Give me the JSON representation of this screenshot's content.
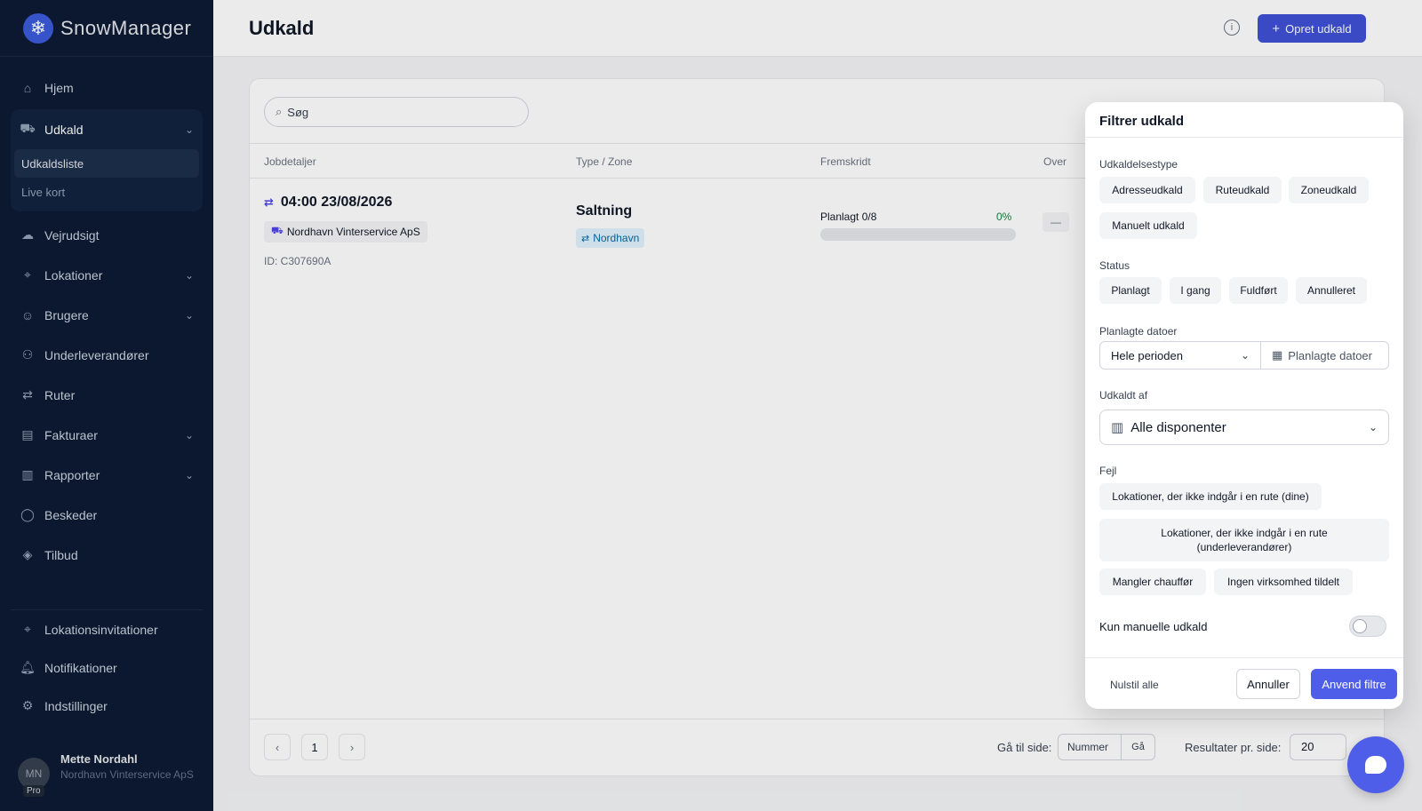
{
  "app": {
    "name": "SnowManager"
  },
  "colors": {
    "sidebar": "#0c1b33",
    "accent": "#4f5ee8",
    "success": "#15803d",
    "zone": "#0369a1"
  },
  "sidebar": {
    "items": [
      {
        "label": "Hjem",
        "icon": "home-icon"
      },
      {
        "label": "Udkald",
        "icon": "truck-icon",
        "expanded": true,
        "children": [
          {
            "label": "Udkaldsliste",
            "active": true
          },
          {
            "label": "Live kort"
          }
        ]
      },
      {
        "label": "Vejrudsigt",
        "icon": "cloud-icon"
      },
      {
        "label": "Lokationer",
        "icon": "location-icon",
        "chevron": true
      },
      {
        "label": "Brugere",
        "icon": "user-icon",
        "chevron": true
      },
      {
        "label": "Underleverandører",
        "icon": "users-icon"
      },
      {
        "label": "Ruter",
        "icon": "route-icon"
      },
      {
        "label": "Fakturaer",
        "icon": "invoice-icon",
        "chevron": true
      },
      {
        "label": "Rapporter",
        "icon": "chart-icon",
        "chevron": true
      },
      {
        "label": "Beskeder",
        "icon": "message-icon"
      },
      {
        "label": "Tilbud",
        "icon": "tag-icon"
      }
    ],
    "bottom_items": [
      {
        "label": "Lokationsinvitationer",
        "icon": "location-invite-icon"
      },
      {
        "label": "Notifikationer",
        "icon": "bell-icon"
      },
      {
        "label": "Indstillinger",
        "icon": "gear-icon"
      }
    ],
    "user": {
      "initials": "MN",
      "badge": "Pro",
      "name": "Mette Nordahl",
      "org": "Nordhavn Vinterservice ApS"
    }
  },
  "header": {
    "title": "Udkald",
    "create_label": "Opret udkald"
  },
  "search": {
    "placeholder": "Søg"
  },
  "table": {
    "columns": [
      "Jobdetaljer",
      "Type / Zone",
      "Fremskridt",
      "Over"
    ],
    "rows": [
      {
        "datetime": "04:00 23/08/2026",
        "org": "Nordhavn Vinterservice ApS",
        "id": "ID: C307690A",
        "type": "Saltning",
        "zone": "Nordhavn",
        "progress_label": "Planlagt 0/8",
        "progress_pct": "0%",
        "progress_value": 0,
        "dash": "—"
      }
    ]
  },
  "pager": {
    "page": "1",
    "goto_label": "Gå til side:",
    "goto_placeholder": "Nummer",
    "goto_button": "Gå",
    "per_page_label": "Resultater pr. side:",
    "per_page": "20"
  },
  "filter": {
    "title": "Filtrer udkald",
    "type_label": "Udkaldelsestype",
    "types": [
      "Adresseudkald",
      "Ruteudkald",
      "Zoneudkald",
      "Manuelt udkald"
    ],
    "status_label": "Status",
    "statuses": [
      "Planlagt",
      "I gang",
      "Fuldført",
      "Annulleret"
    ],
    "dates_label": "Planlagte datoer",
    "date_range": "Hele perioden",
    "date_picker": "Planlagte datoer",
    "dispatched_by_label": "Udkaldt af",
    "dispatcher": "Alle disponenter",
    "errors_label": "Fejl",
    "errors": [
      "Lokationer, der ikke indgår i en rute (dine)",
      "Lokationer, der ikke indgår i en rute (underleverandører)",
      "Mangler chauffør",
      "Ingen virksomhed tildelt"
    ],
    "manual_only_label": "Kun manuelle udkald",
    "manual_only": false,
    "reset_label": "Nulstil alle",
    "cancel_label": "Annuller",
    "apply_label": "Anvend filtre"
  }
}
